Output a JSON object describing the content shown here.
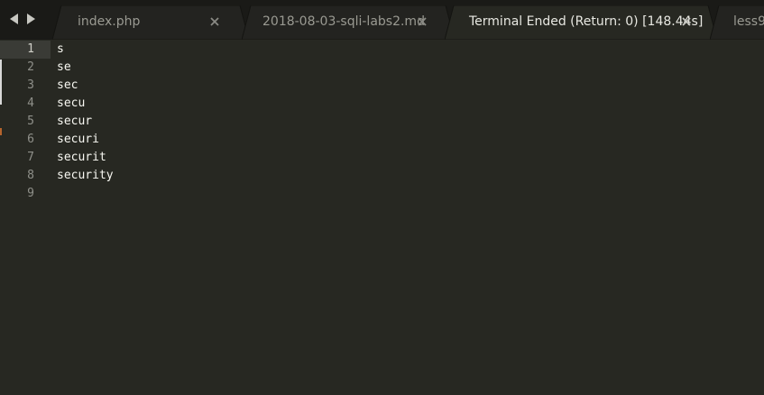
{
  "tabs": [
    {
      "label": "index.php",
      "active": false,
      "closable": true
    },
    {
      "label": "2018-08-03-sqli-labs2.md",
      "active": false,
      "closable": true
    },
    {
      "label": "Terminal Ended (Return: 0) [148.44s]",
      "active": true,
      "closable": true
    },
    {
      "label": "less9-",
      "active": false,
      "closable": false
    }
  ],
  "editor": {
    "current_line": 1,
    "lines": [
      {
        "number": "1",
        "text": "s"
      },
      {
        "number": "2",
        "text": "se"
      },
      {
        "number": "3",
        "text": "sec"
      },
      {
        "number": "4",
        "text": "secu"
      },
      {
        "number": "5",
        "text": "secur"
      },
      {
        "number": "6",
        "text": "securi"
      },
      {
        "number": "7",
        "text": "securit"
      },
      {
        "number": "8",
        "text": "security"
      },
      {
        "number": "9",
        "text": ""
      }
    ]
  },
  "colors": {
    "background": "#272822",
    "tabbar": "#1a1a17",
    "tab_inactive": "#232320",
    "tab_active": "#272822",
    "text": "#f8f8f2",
    "line_number": "#8f908a"
  },
  "icons": {
    "nav_back": "triangle-left-icon",
    "nav_forward": "triangle-right-icon",
    "tab_close": "close-icon"
  }
}
